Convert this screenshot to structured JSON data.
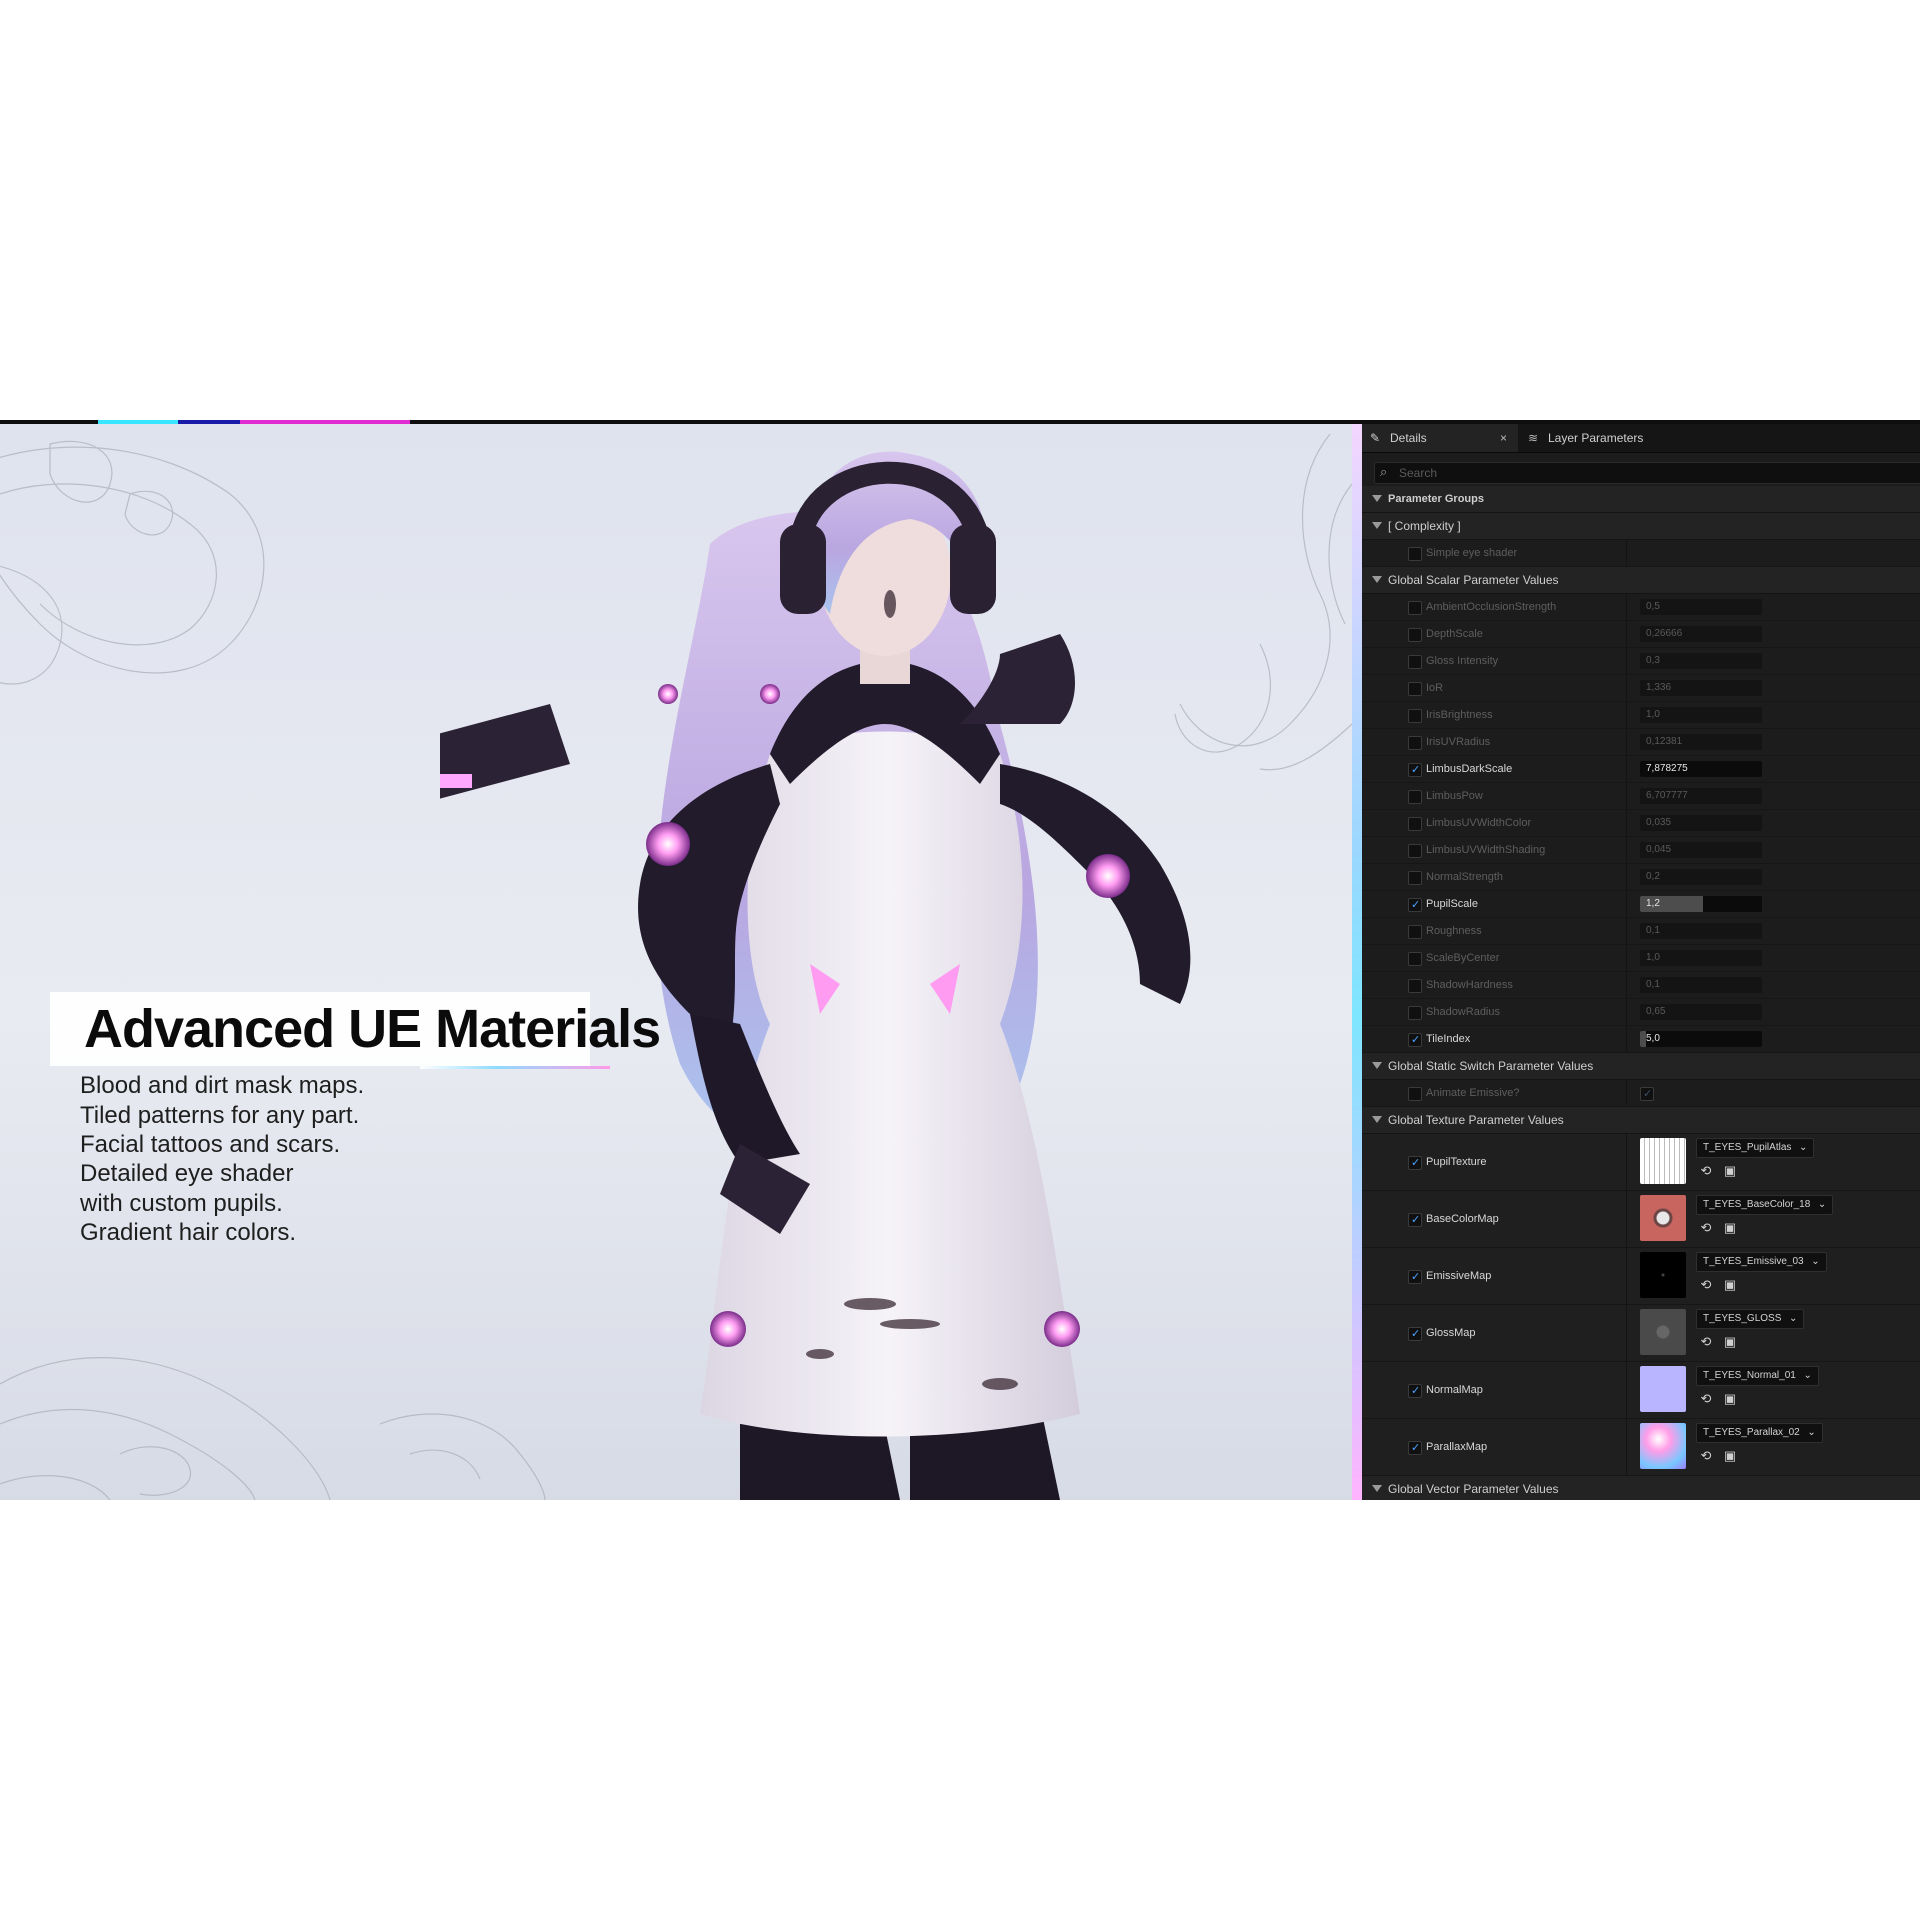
{
  "title": "Advanced UE Materials",
  "features": [
    "Blood and dirt mask maps.",
    "Tiled patterns for any part.",
    "Facial tattoos and scars.",
    "Detailed eye shader",
    "with custom pupils.",
    "Gradient hair colors."
  ],
  "accent_colors": [
    "#38e6ff",
    "#1a1aa8",
    "#e02ad2"
  ],
  "panel": {
    "tabs": [
      {
        "label": "Details",
        "icon": "pencil-icon",
        "active": true
      },
      {
        "label": "Layer Parameters",
        "icon": "layers-icon",
        "active": false
      }
    ],
    "search_placeholder": "Search",
    "groups": {
      "parameter_groups": "Parameter Groups",
      "complexity": "[ Complexity ]",
      "scalar": "Global Scalar Parameter Values",
      "static_switch": "Global Static Switch Parameter Values",
      "texture": "Global Texture Parameter Values",
      "vector": "Global Vector Parameter Values"
    },
    "complexity_params": [
      {
        "name": "Simple eye shader",
        "enabled": false
      }
    ],
    "scalar_params": [
      {
        "name": "AmbientOcclusionStrength",
        "value": "0,5",
        "enabled": false,
        "fill": 0
      },
      {
        "name": "DepthScale",
        "value": "0,26666",
        "enabled": false,
        "fill": 0
      },
      {
        "name": "Gloss Intensity",
        "value": "0,3",
        "enabled": false,
        "fill": 0
      },
      {
        "name": "IoR",
        "value": "1,336",
        "enabled": false,
        "fill": 0
      },
      {
        "name": "IrisBrightness",
        "value": "1,0",
        "enabled": false,
        "fill": 0
      },
      {
        "name": "IrisUVRadius",
        "value": "0,12381",
        "enabled": false,
        "fill": 0
      },
      {
        "name": "LimbusDarkScale",
        "value": "7,878275",
        "enabled": true,
        "fill": 0
      },
      {
        "name": "LimbusPow",
        "value": "6,707777",
        "enabled": false,
        "fill": 0
      },
      {
        "name": "LimbusUVWidthColor",
        "value": "0,035",
        "enabled": false,
        "fill": 0
      },
      {
        "name": "LimbusUVWidthShading",
        "value": "0,045",
        "enabled": false,
        "fill": 0
      },
      {
        "name": "NormalStrength",
        "value": "0,2",
        "enabled": false,
        "fill": 0
      },
      {
        "name": "PupilScale",
        "value": "1,2",
        "enabled": true,
        "fill": 0.52
      },
      {
        "name": "Roughness",
        "value": "0,1",
        "enabled": false,
        "fill": 0
      },
      {
        "name": "ScaleByCenter",
        "value": "1,0",
        "enabled": false,
        "fill": 0
      },
      {
        "name": "ShadowHardness",
        "value": "0,1",
        "enabled": false,
        "fill": 0
      },
      {
        "name": "ShadowRadius",
        "value": "0,65",
        "enabled": false,
        "fill": 0
      },
      {
        "name": "TileIndex",
        "value": "5,0",
        "enabled": true,
        "fill": 0.05
      }
    ],
    "switch_params": [
      {
        "name": "Animate Emissive?",
        "enabled": false,
        "value_checked": true
      }
    ],
    "texture_params": [
      {
        "name": "PupilTexture",
        "asset": "T_EYES_PupilAtlas",
        "thumb": "atlas"
      },
      {
        "name": "BaseColorMap",
        "asset": "T_EYES_BaseColor_18",
        "thumb": "basecolor"
      },
      {
        "name": "EmissiveMap",
        "asset": "T_EYES_Emissive_03",
        "thumb": "emissive"
      },
      {
        "name": "GlossMap",
        "asset": "T_EYES_GLOSS",
        "thumb": "gloss"
      },
      {
        "name": "NormalMap",
        "asset": "T_EYES_Normal_01",
        "thumb": "normal"
      },
      {
        "name": "ParallaxMap",
        "asset": "T_EYES_Parallax_02",
        "thumb": "parallax"
      }
    ]
  }
}
